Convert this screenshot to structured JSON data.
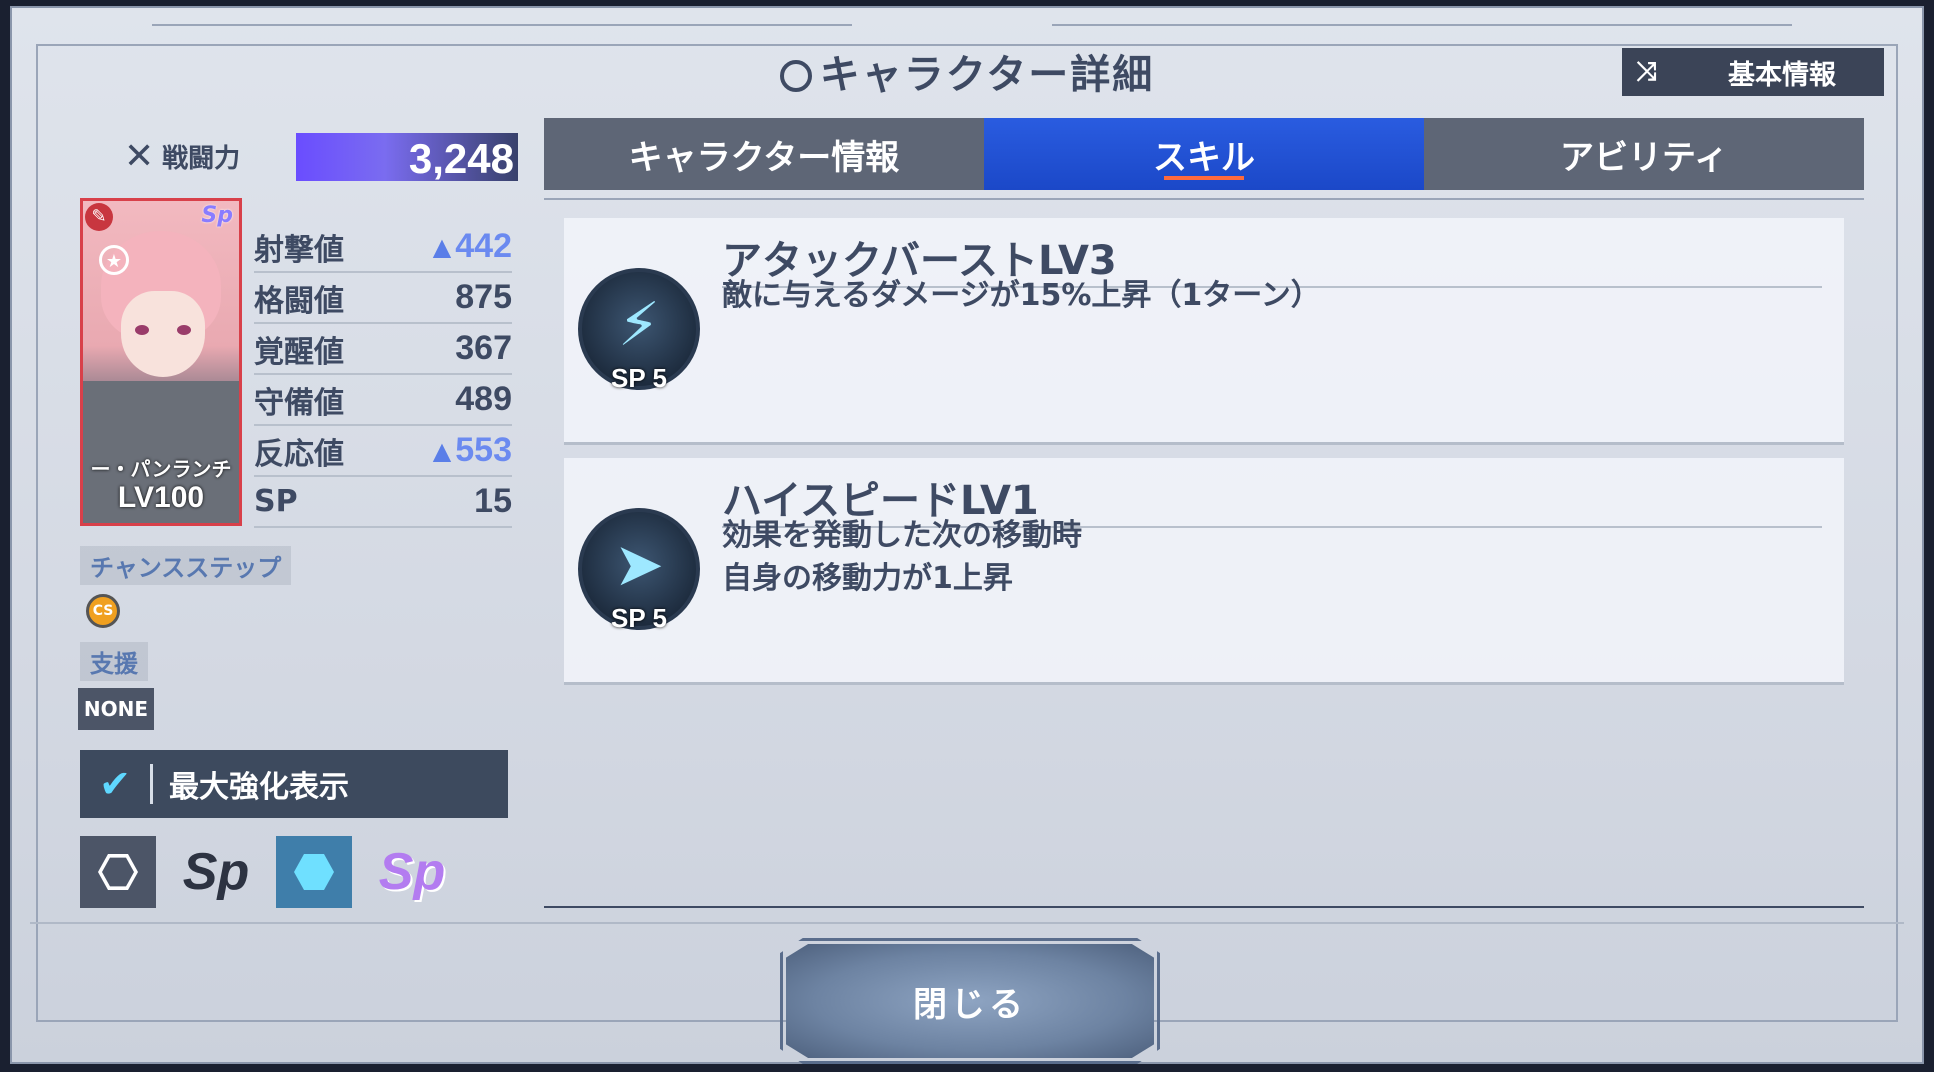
{
  "header": {
    "title": "キャラクター詳細",
    "basic_info_button": "基本情報"
  },
  "power": {
    "label": "戦闘力",
    "value": "3,248"
  },
  "card": {
    "name": "ー・パンランチ",
    "level": "LV100",
    "badge": "Sp"
  },
  "stats": [
    {
      "name": "射撃値",
      "value": "442",
      "boosted": true
    },
    {
      "name": "格闘値",
      "value": "875",
      "boosted": false
    },
    {
      "name": "覚醒値",
      "value": "367",
      "boosted": false
    },
    {
      "name": "守備値",
      "value": "489",
      "boosted": false
    },
    {
      "name": "反応値",
      "value": "553",
      "boosted": true
    },
    {
      "name": "SP",
      "value": "15",
      "boosted": false
    }
  ],
  "chance_step": {
    "label": "チャンスステップ",
    "icon_text": "CS"
  },
  "support": {
    "label": "支援",
    "value": "NONE"
  },
  "max_enhance": {
    "label": "最大強化表示",
    "checked": true
  },
  "filter_icons": [
    "hexagon-outline-icon",
    "sp-dark-icon",
    "hexagon-filled-icon",
    "sp-color-icon"
  ],
  "filter_sp_text": "Sp",
  "tabs": [
    {
      "label": "キャラクター情報",
      "active": false
    },
    {
      "label": "スキル",
      "active": true
    },
    {
      "label": "アビリティ",
      "active": false
    }
  ],
  "skills": [
    {
      "title": "アタックバーストLV3",
      "description": [
        "敵に与えるダメージが15%上昇（1ターン）"
      ],
      "sp": "SP 5",
      "icon": "lightning-icon"
    },
    {
      "title": "ハイスピードLV1",
      "description": [
        "効果を発動した次の移動時",
        "自身の移動力が1上昇"
      ],
      "sp": "SP 5",
      "icon": "speed-boot-icon"
    }
  ],
  "close_button": "閉じる",
  "colors": {
    "accent_blue": "#1b48c8",
    "tab_underline": "#ff6a3d",
    "stat_boost": "#6b8af0",
    "text": "#3e4a63"
  }
}
